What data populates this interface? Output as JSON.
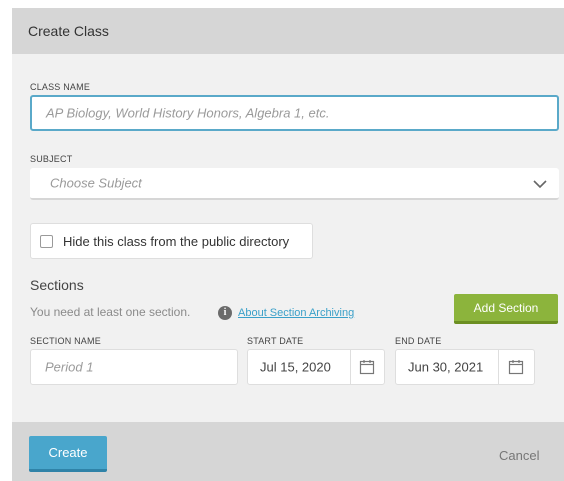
{
  "dialog": {
    "title": "Create Class"
  },
  "class_name": {
    "label": "CLASS NAME",
    "placeholder": "AP Biology, World History Honors, Algebra 1, etc."
  },
  "subject": {
    "label": "SUBJECT",
    "placeholder": "Choose Subject",
    "icon": "chevron-down-icon"
  },
  "hide_checkbox": {
    "label": "Hide this class from the public directory",
    "checked": false
  },
  "sections": {
    "heading": "Sections",
    "note": "You need at least one section.",
    "info_icon": "info-icon",
    "about_link": "About Section Archiving",
    "add_button": "Add Section",
    "add_button_color": "#8cb43c",
    "section_name_label": "SECTION NAME",
    "section_name_placeholder": "Period 1",
    "start_date_label": "START DATE",
    "start_date_value": "Jul 15, 2020",
    "end_date_label": "END DATE",
    "end_date_value": "Jun 30, 2021",
    "calendar_icon": "calendar-icon"
  },
  "footer": {
    "create_label": "Create",
    "create_color": "#49a6cc",
    "cancel_label": "Cancel"
  }
}
